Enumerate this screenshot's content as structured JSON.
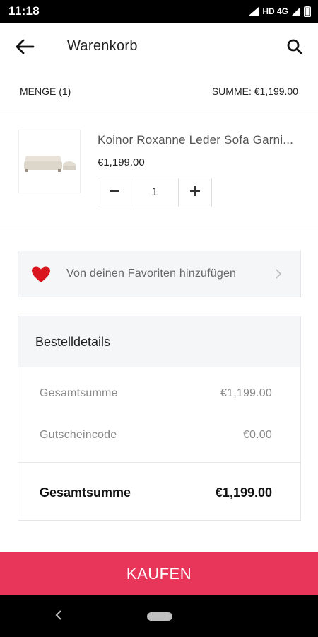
{
  "status_bar": {
    "time": "11:18",
    "network": "HD 4G"
  },
  "header": {
    "title": "Warenkorb"
  },
  "summary": {
    "quantity_label": "MENGE (1)",
    "total_label": "SUMME: €1,199.00"
  },
  "cart_item": {
    "name": "Koinor Roxanne Leder Sofa Garni...",
    "price": "€1,199.00",
    "quantity": "1"
  },
  "favorites": {
    "label": "Von deinen Favoriten hinzufügen"
  },
  "order_details": {
    "title": "Bestelldetails",
    "lines": [
      {
        "label": "Gesamtsumme",
        "value": "€1,199.00"
      },
      {
        "label": "Gutscheincode",
        "value": "€0.00"
      }
    ],
    "total": {
      "label": "Gesamtsumme",
      "value": "€1,199.00"
    }
  },
  "buy_button": {
    "label": "KAUFEN"
  },
  "colors": {
    "accent": "#e8365a",
    "heart": "#d9141f",
    "panel_bg": "#f5f6f8"
  },
  "icons": [
    "arrow-left-icon",
    "search-icon",
    "minus-icon",
    "plus-icon",
    "heart-icon",
    "chevron-right-icon",
    "signal-icon",
    "battery-icon"
  ]
}
